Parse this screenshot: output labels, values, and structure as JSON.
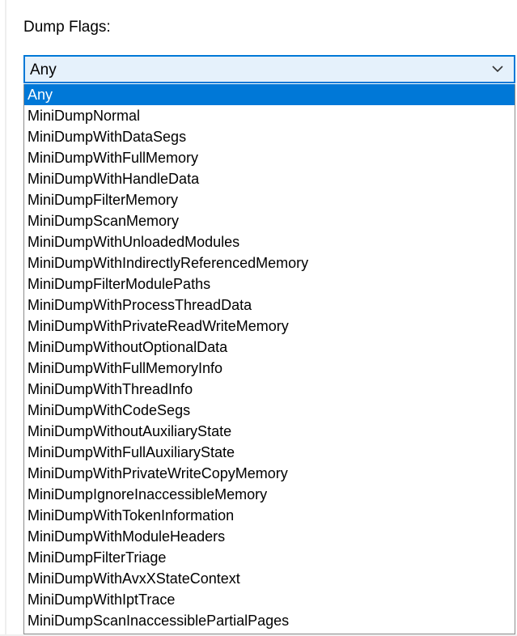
{
  "form": {
    "label": "Dump Flags:",
    "selected_value": "Any"
  },
  "dropdown": {
    "items": [
      "Any",
      "MiniDumpNormal",
      "MiniDumpWithDataSegs",
      "MiniDumpWithFullMemory",
      "MiniDumpWithHandleData",
      "MiniDumpFilterMemory",
      "MiniDumpScanMemory",
      "MiniDumpWithUnloadedModules",
      "MiniDumpWithIndirectlyReferencedMemory",
      "MiniDumpFilterModulePaths",
      "MiniDumpWithProcessThreadData",
      "MiniDumpWithPrivateReadWriteMemory",
      "MiniDumpWithoutOptionalData",
      "MiniDumpWithFullMemoryInfo",
      "MiniDumpWithThreadInfo",
      "MiniDumpWithCodeSegs",
      "MiniDumpWithoutAuxiliaryState",
      "MiniDumpWithFullAuxiliaryState",
      "MiniDumpWithPrivateWriteCopyMemory",
      "MiniDumpIgnoreInaccessibleMemory",
      "MiniDumpWithTokenInformation",
      "MiniDumpWithModuleHeaders",
      "MiniDumpFilterTriage",
      "MiniDumpWithAvxXStateContext",
      "MiniDumpWithIptTrace",
      "MiniDumpScanInaccessiblePartialPages"
    ],
    "highlighted_item": "Any"
  },
  "icons": {
    "combo_arrow": "chevron-down-icon"
  },
  "colors": {
    "accent": "#0078d7",
    "combo_background": "#e5f1fb",
    "highlight_text": "#ffffff"
  }
}
